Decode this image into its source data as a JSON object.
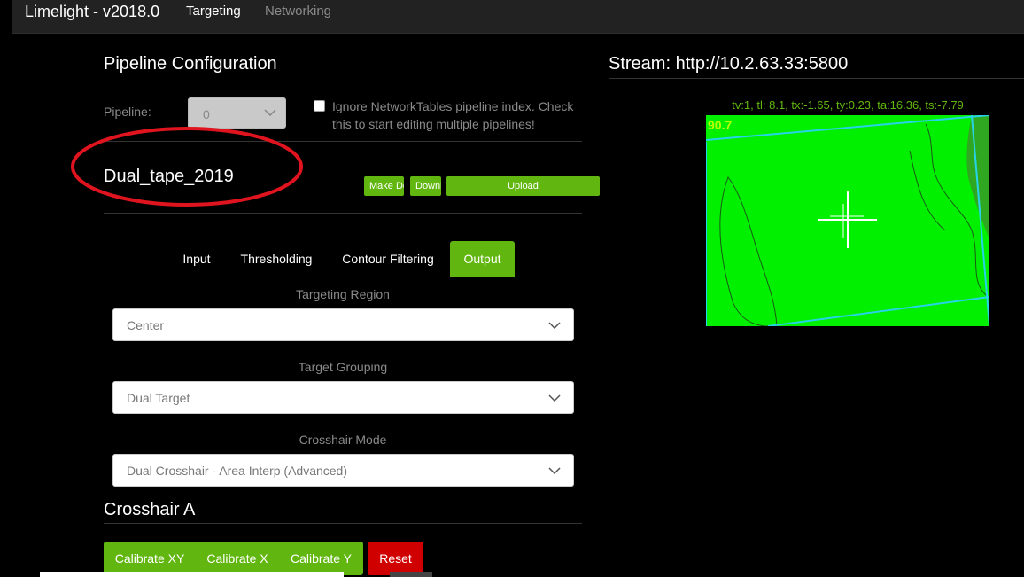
{
  "app": {
    "title": "Limelight - v2018.0",
    "nav": [
      "Targeting",
      "Networking"
    ]
  },
  "pipeline": {
    "heading": "Pipeline Configuration",
    "label": "Pipeline:",
    "index_value": "0",
    "ignore_checkbox_label": "Ignore NetworkTables pipeline index. Check this to start editing multiple pipelines!",
    "ignore_checked": false,
    "name": "Dual_tape_2019",
    "buttons": {
      "make_default": "Make De",
      "download": "Downlo",
      "upload": "Upload"
    }
  },
  "tabs": [
    {
      "label": "Input",
      "active": false
    },
    {
      "label": "Thresholding",
      "active": false
    },
    {
      "label": "Contour Filtering",
      "active": false
    },
    {
      "label": "Output",
      "active": true
    }
  ],
  "output": {
    "targeting_region": {
      "label": "Targeting Region",
      "value": "Center"
    },
    "target_grouping": {
      "label": "Target Grouping",
      "value": "Dual Target"
    },
    "crosshair_mode": {
      "label": "Crosshair Mode",
      "value": "Dual Crosshair - Area Interp (Advanced)"
    }
  },
  "crosshair": {
    "heading": "Crosshair A",
    "buttons": {
      "calibrate_xy": "Calibrate XY",
      "calibrate_x": "Calibrate X",
      "calibrate_y": "Calibrate Y",
      "reset": "Reset"
    }
  },
  "stream": {
    "title": "Stream: http://10.2.63.33:5800",
    "metrics": "tv:1, tl: 8.1, tx:-1.65, ty:0.23, ta:16.36, ts:-7.79",
    "overlay_angle": "90.7"
  },
  "colors": {
    "accent_green": "#61b70f",
    "danger_red": "#d00000",
    "annotation_red": "#e0141e",
    "stream_green": "#00f000",
    "contour_cyan": "#27d3e8"
  }
}
